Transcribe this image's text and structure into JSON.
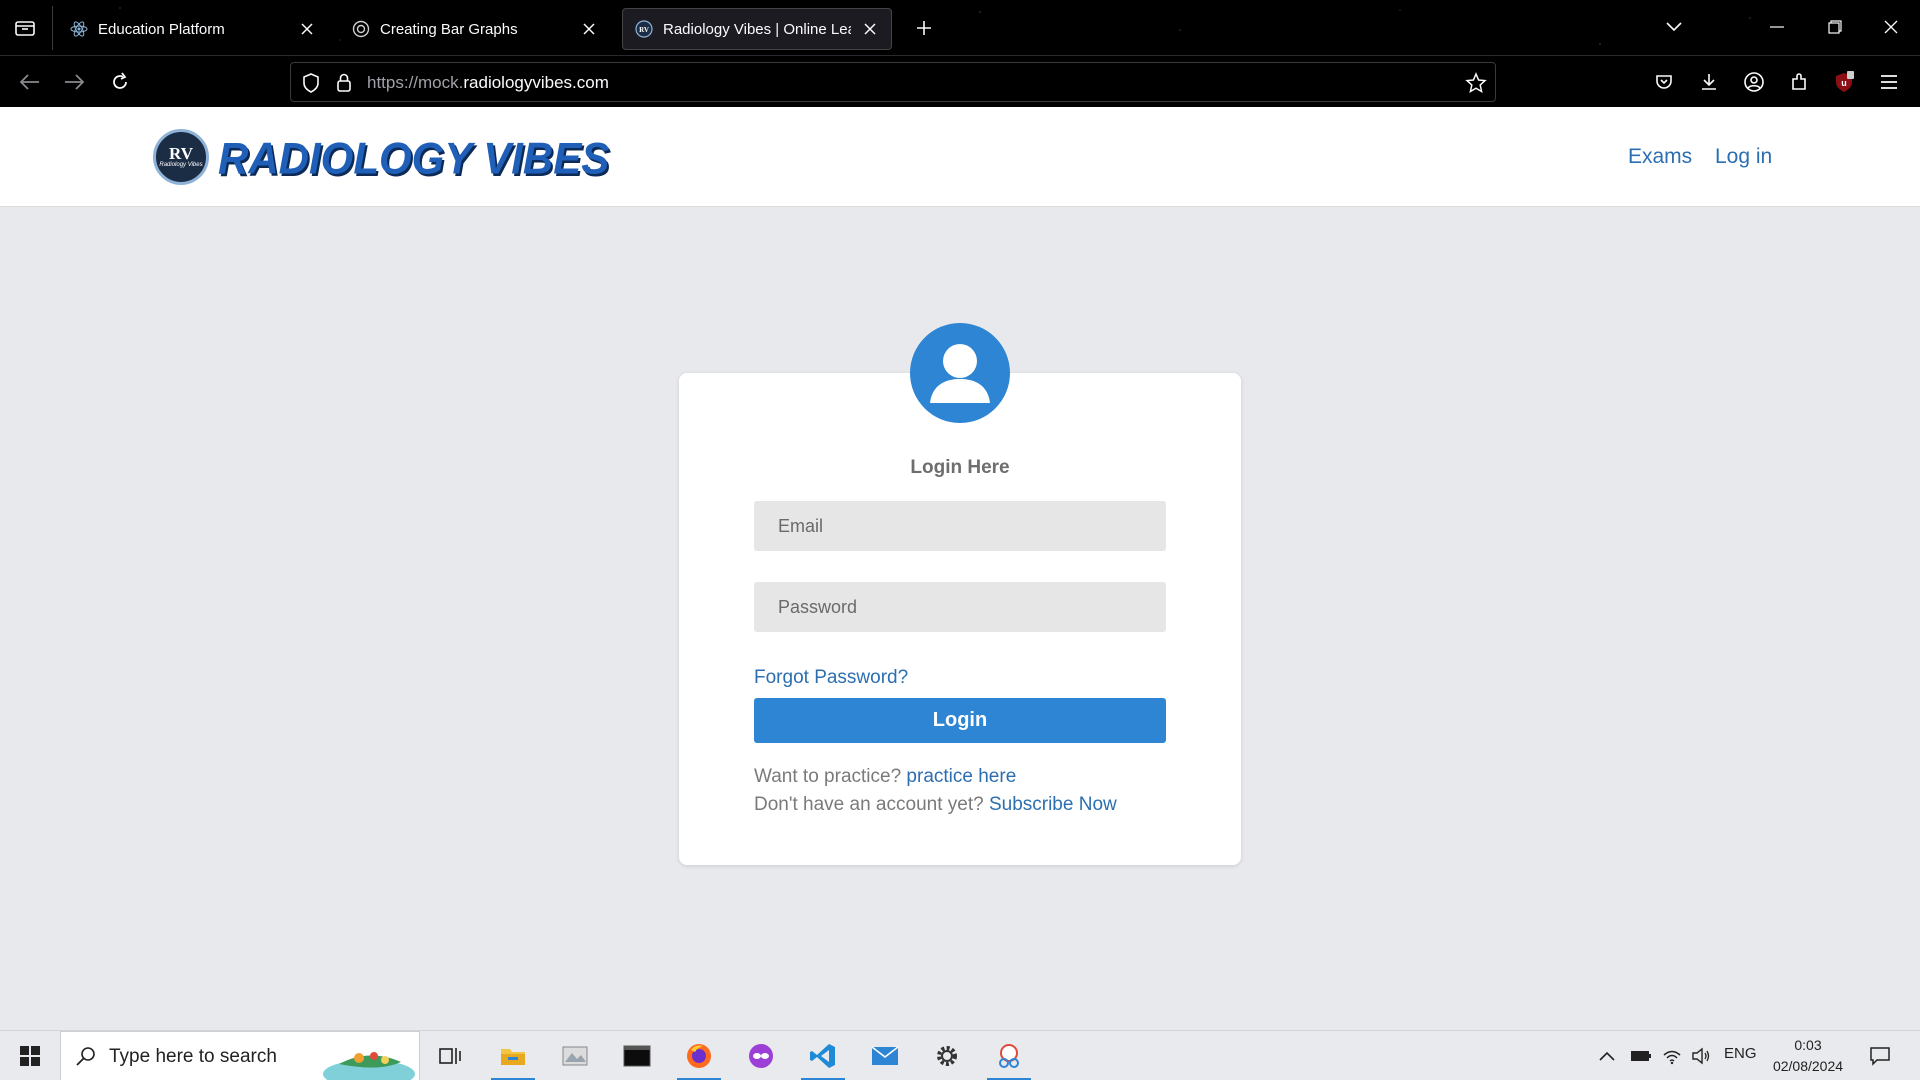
{
  "browser": {
    "tabs": [
      {
        "title": "Education Platform",
        "icon": "react-icon"
      },
      {
        "title": "Creating Bar Graphs",
        "icon": "openai-icon"
      },
      {
        "title": "Radiology Vibes | Online Learni",
        "icon": "rv-favicon",
        "active": true
      }
    ],
    "url_prefix": "https://mock.",
    "url_domain": "radiologyvibes.com"
  },
  "site": {
    "logo_badge": "RV",
    "logo_badge_sub": "Radiology Vibes",
    "logo_text": "RADIOLOGY VIBES",
    "nav": {
      "exams": "Exams",
      "login": "Log in"
    }
  },
  "login": {
    "title": "Login Here",
    "email_placeholder": "Email",
    "password_placeholder": "Password",
    "forgot": "Forgot Password?",
    "button": "Login",
    "practice_prompt": "Want to practice?",
    "practice_link": "practice here",
    "account_prompt": "Don't have an account yet?",
    "subscribe_link": "Subscribe Now"
  },
  "taskbar": {
    "search_placeholder": "Type here to search",
    "language": "ENG",
    "time": "0:03",
    "date": "02/08/2024"
  },
  "colors": {
    "accent": "#2d85d4",
    "link": "#2c6fb1",
    "page_bg": "#e8e9ec"
  }
}
